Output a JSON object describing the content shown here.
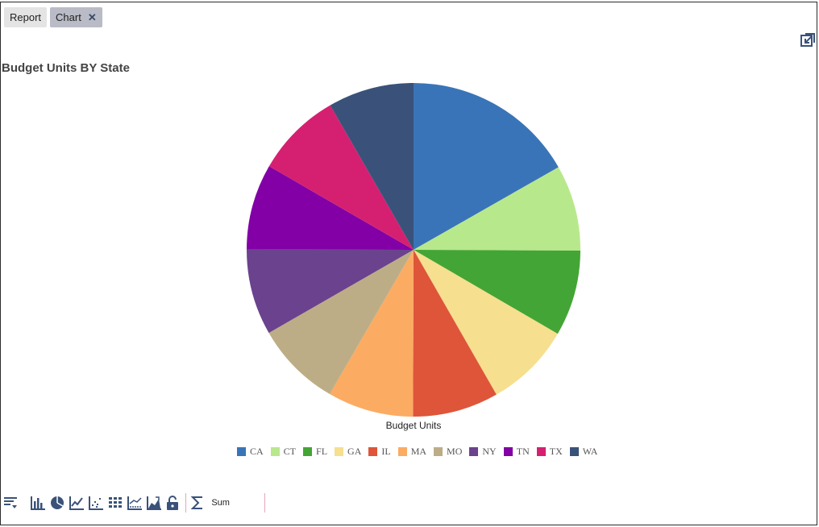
{
  "tabs": [
    {
      "label": "Report"
    },
    {
      "label": "Chart",
      "close": "✕"
    }
  ],
  "chart_data": {
    "type": "pie",
    "title": "Budget Units BY State",
    "xlabel": "Budget Units",
    "categories": [
      "CA",
      "CT",
      "FL",
      "GA",
      "IL",
      "MA",
      "MO",
      "NY",
      "TN",
      "TX",
      "WA"
    ],
    "values": [
      16.7,
      8.3,
      8.3,
      8.3,
      8.3,
      8.3,
      8.3,
      8.3,
      8.3,
      8.3,
      8.3
    ],
    "colors": [
      "#3a74b8",
      "#b8e88c",
      "#43a535",
      "#f6df8e",
      "#de553a",
      "#fcab62",
      "#bdad86",
      "#6b428e",
      "#8200a6",
      "#d52071",
      "#3a5279"
    ],
    "legend": "bottom"
  },
  "toolbar": {
    "sum_label": "Sum",
    "icons": [
      "sort-icon",
      "bar-chart-icon",
      "pie-chart-icon",
      "line-chart-icon",
      "scatter-chart-icon",
      "table-grid-icon",
      "trend-chart-icon",
      "area-chart-icon",
      "lock-icon",
      "sigma-icon"
    ]
  }
}
